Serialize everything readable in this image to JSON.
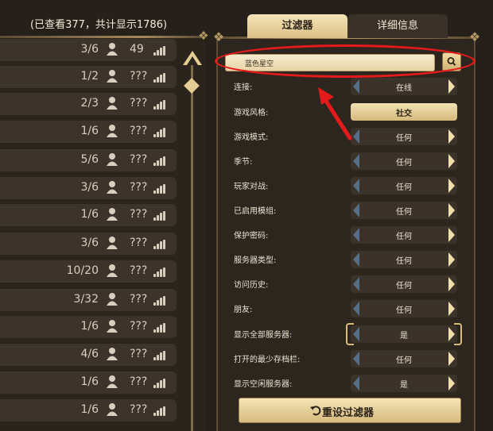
{
  "server_list": {
    "viewed_text": "(已查看377，共计显示1786)",
    "rows": [
      {
        "players": "3/6",
        "ping": "49"
      },
      {
        "players": "1/2",
        "ping": "???"
      },
      {
        "players": "2/3",
        "ping": "???"
      },
      {
        "players": "1/6",
        "ping": "???"
      },
      {
        "players": "5/6",
        "ping": "???"
      },
      {
        "players": "3/6",
        "ping": "???"
      },
      {
        "players": "1/6",
        "ping": "???"
      },
      {
        "players": "3/6",
        "ping": "???"
      },
      {
        "players": "10/20",
        "ping": "???"
      },
      {
        "players": "3/32",
        "ping": "???"
      },
      {
        "players": "1/6",
        "ping": "???"
      },
      {
        "players": "4/6",
        "ping": "???"
      },
      {
        "players": "1/6",
        "ping": "???"
      },
      {
        "players": "1/6",
        "ping": "???"
      }
    ]
  },
  "tabs": {
    "filters": "过滤器",
    "details": "详细信息"
  },
  "search": {
    "value": "蓝色星空"
  },
  "filters": [
    {
      "label": "连接:",
      "value": "在线"
    },
    {
      "label": "游戏风格:",
      "value": "社交"
    },
    {
      "label": "游戏模式:",
      "value": "任何"
    },
    {
      "label": "季节:",
      "value": "任何"
    },
    {
      "label": "玩家对战:",
      "value": "任何"
    },
    {
      "label": "已启用模组:",
      "value": "任何"
    },
    {
      "label": "保护密码:",
      "value": "任何"
    },
    {
      "label": "服务器类型:",
      "value": "任何"
    },
    {
      "label": "访问历史:",
      "value": "任何"
    },
    {
      "label": "朋友:",
      "value": "任何"
    },
    {
      "label": "显示全部服务器:",
      "value": "是"
    },
    {
      "label": "打开的最少存档栏:",
      "value": "任何"
    },
    {
      "label": "显示空闲服务器:",
      "value": "是"
    }
  ],
  "reset_button": {
    "label": "重设过滤器"
  },
  "colors": {
    "annotation": "#e51b1b",
    "gold": "#dcc086"
  }
}
